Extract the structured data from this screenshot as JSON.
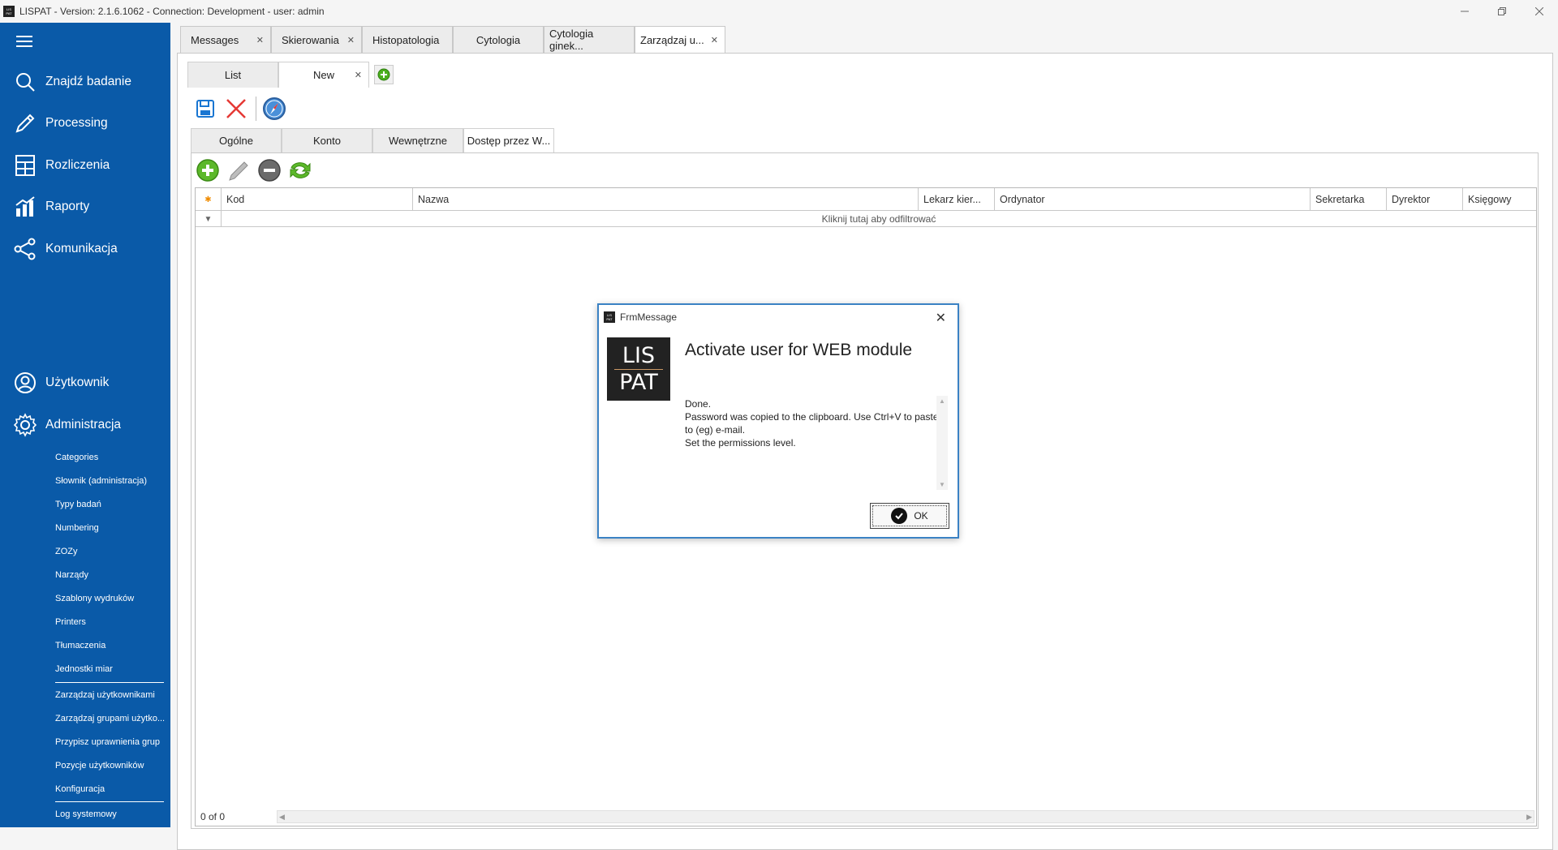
{
  "window": {
    "title": "LISPAT - Version: 2.1.6.1062 - Connection: Development - user: admin",
    "icon_text": "LIS PAT"
  },
  "sidebar": {
    "nav": [
      {
        "label": "Znajdź badanie",
        "icon": "search-icon"
      },
      {
        "label": "Processing",
        "icon": "pen-icon"
      },
      {
        "label": "Rozliczenia",
        "icon": "calculator-icon"
      },
      {
        "label": "Raporty",
        "icon": "chart-icon"
      },
      {
        "label": "Komunikacja",
        "icon": "share-icon"
      },
      {
        "label": "Użytkownik",
        "icon": "user-icon"
      },
      {
        "label": "Administracja",
        "icon": "gear-icon"
      }
    ],
    "sub_items": [
      "Categories",
      "Słownik (administracja)",
      "Typy badań",
      "Numbering",
      "ZOZy",
      "Narządy",
      "Szablony wydruków",
      "Printers",
      "Tłumaczenia",
      "Jednostki miar",
      "Zarządzaj użytkownikami",
      "Zarządzaj grupami użytko...",
      "Przypisz uprawnienia grup",
      "Pozycje użytkowników",
      "Konfiguracja",
      "Log systemowy"
    ]
  },
  "doc_tabs": [
    {
      "label": "Messages",
      "closable": true
    },
    {
      "label": "Skierowania",
      "closable": true
    },
    {
      "label": "Histopatologia",
      "closable": false
    },
    {
      "label": "Cytologia",
      "closable": false
    },
    {
      "label": "Cytologia ginek...",
      "closable": false
    },
    {
      "label": "Zarządzaj u...",
      "closable": true
    }
  ],
  "sub_tabs": [
    {
      "label": "List"
    },
    {
      "label": "New"
    }
  ],
  "inner_tabs": [
    "Ogólne",
    "Konto",
    "Wewnętrzne",
    "Dostęp przez W..."
  ],
  "grid": {
    "columns": [
      "Kod",
      "Nazwa",
      "Lekarz kier...",
      "Ordynator",
      "Sekretarka",
      "Dyrektor",
      "Księgowy"
    ],
    "filter_hint": "Kliknij tutaj aby odfiltrować",
    "row_count": "0 of 0"
  },
  "dialog": {
    "title": "FrmMessage",
    "logo_top": "LIS",
    "logo_bottom": "PAT",
    "heading": "Activate user for WEB module",
    "body": [
      "Done.",
      "Password was copied to the clipboard. Use Ctrl+V to paste to (eg) e-mail.",
      "Set the permissions level."
    ],
    "ok_label": "OK"
  }
}
